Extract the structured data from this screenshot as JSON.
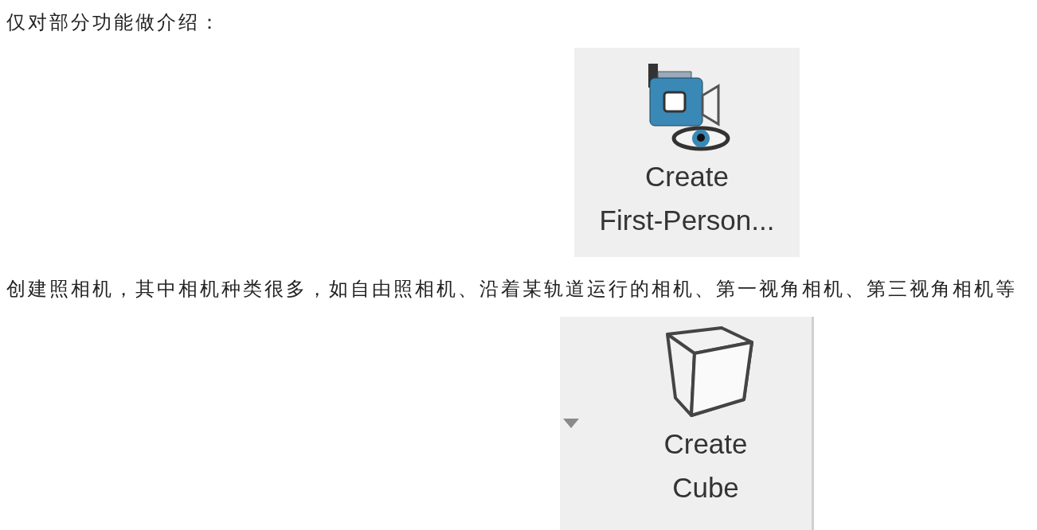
{
  "intro": "仅对部分功能做介绍：",
  "sections": [
    {
      "button": {
        "kind": "camera",
        "label": "Create\nFirst-Person...",
        "dropdown": false
      },
      "caption": "创建照相机，其中相机种类很多，如自由照相机、沿着某轨道运行的相机、第一视角相机、第三视角相机等"
    },
    {
      "button": {
        "kind": "cube",
        "label": "Create\nCube",
        "dropdown": true
      }
    }
  ]
}
